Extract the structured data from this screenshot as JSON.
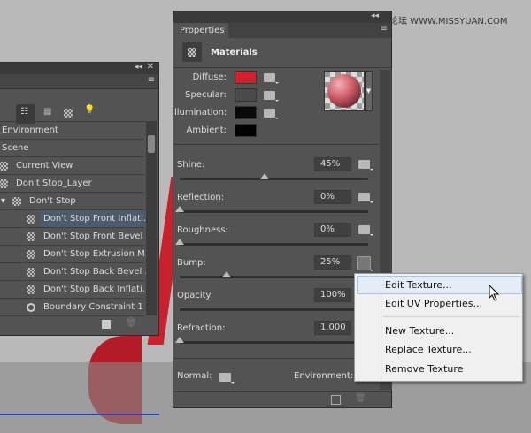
{
  "watermark": "思缘设计论坛  WWW.MISSYUAN.COM",
  "scene_panel": {
    "items": [
      {
        "label": "Environment",
        "indent": 0,
        "icon": "none"
      },
      {
        "label": "Scene",
        "indent": 0,
        "icon": "none"
      },
      {
        "label": "Current View",
        "indent": 1,
        "icon": "camera-icon"
      },
      {
        "label": "Don't Stop_Layer",
        "indent": 1,
        "icon": "layer-icon"
      },
      {
        "label": "Don't Stop",
        "indent": 2,
        "icon": "mesh-icon"
      },
      {
        "label": "Don't Stop Front Inflati...",
        "indent": 3,
        "icon": "material-icon",
        "selected": true
      },
      {
        "label": "Don't Stop Front Bevel ...",
        "indent": 3,
        "icon": "material-icon"
      },
      {
        "label": "Don't Stop Extrusion M...",
        "indent": 3,
        "icon": "material-icon"
      },
      {
        "label": "Don't Stop Back Bevel ...",
        "indent": 3,
        "icon": "material-icon"
      },
      {
        "label": "Don't Stop Back Inflati...",
        "indent": 3,
        "icon": "material-icon"
      },
      {
        "label": "Boundary Constraint 1",
        "indent": 3,
        "icon": "constraint-icon"
      }
    ]
  },
  "properties": {
    "tab": "Properties",
    "section": "Materials",
    "diffuse_label": "Diffuse:",
    "specular_label": "Specular:",
    "illumination_label": "Illumination:",
    "ambient_label": "Ambient:",
    "colors": {
      "diffuse": "#d4202c",
      "specular": "#4a4a4a",
      "illumination": "#0a0a0a",
      "ambient": "#020202"
    },
    "sliders": [
      {
        "label": "Shine:",
        "value": "45%",
        "fraction": 0.45
      },
      {
        "label": "Reflection:",
        "value": "0%",
        "fraction": 0
      },
      {
        "label": "Roughness:",
        "value": "0%",
        "fraction": 0
      },
      {
        "label": "Bump:",
        "value": "25%",
        "fraction": 0.25
      },
      {
        "label": "Opacity:",
        "value": "100%",
        "fraction": 1
      },
      {
        "label": "Refraction:",
        "value": "1.000",
        "fraction": 0
      }
    ],
    "normal_label": "Normal:",
    "environment_label": "Environment:"
  },
  "context_menu": {
    "items": [
      "Edit Texture...",
      "Edit UV Properties...",
      "New Texture...",
      "Replace Texture...",
      "Remove Texture"
    ],
    "highlighted": 0
  }
}
